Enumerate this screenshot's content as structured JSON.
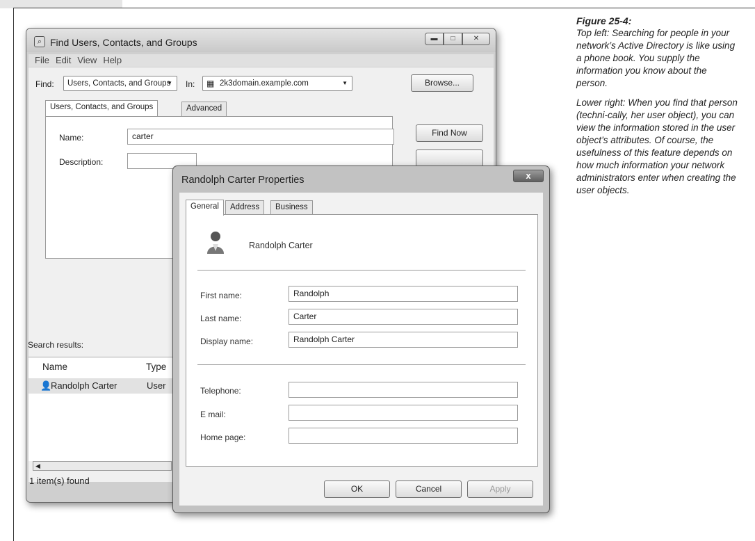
{
  "caption": {
    "figure": "Figure 25-4:",
    "para1": "Top left: Searching for people in your network’s Active Directory is like using a phone book. You supply the information you know about the person.",
    "para2": "Lower right: When you find that person (techni-cally, her user object), you can view the information stored in the user object’s attributes. Of course, the usefulness of this feature depends on how much information your network administrators enter when creating the user objects."
  },
  "find_window": {
    "title": "Find Users, Contacts, and Groups",
    "menus": [
      "File",
      "Edit",
      "View",
      "Help"
    ],
    "find_label": "Find:",
    "find_value": "Users, Contacts, and Groups",
    "in_label": "In:",
    "in_value": "2k3domain.example.com",
    "browse_button": "Browse...",
    "tabs": [
      "Users, Contacts, and Groups",
      "Advanced"
    ],
    "name_label": "Name:",
    "name_value": "carter",
    "description_label": "Description:",
    "find_now_button": "Find Now",
    "search_results_label": "Search results:",
    "columns": [
      "Name",
      "Type"
    ],
    "rows": [
      {
        "name": "Randolph Carter",
        "type": "User"
      }
    ],
    "status": "1 item(s) found"
  },
  "properties_dialog": {
    "title": "Randolph Carter Properties",
    "close_label": "x",
    "tabs": [
      "General",
      "Address",
      "Business"
    ],
    "display_header": "Randolph Carter",
    "fields": {
      "first_name_label": "First name:",
      "first_name_value": "Randolph",
      "last_name_label": "Last name:",
      "last_name_value": "Carter",
      "display_name_label": "Display name:",
      "display_name_value": "Randolph Carter",
      "telephone_label": "Telephone:",
      "telephone_value": "",
      "email_label": "E mail:",
      "email_value": "",
      "home_page_label": "Home page:",
      "home_page_value": ""
    },
    "ok_button": "OK",
    "cancel_button": "Cancel",
    "apply_button": "Apply"
  },
  "icons": [
    "directory-icon",
    "user-icon",
    "dropdown-arrow-icon",
    "minimize-icon",
    "maximize-icon",
    "close-icon"
  ]
}
